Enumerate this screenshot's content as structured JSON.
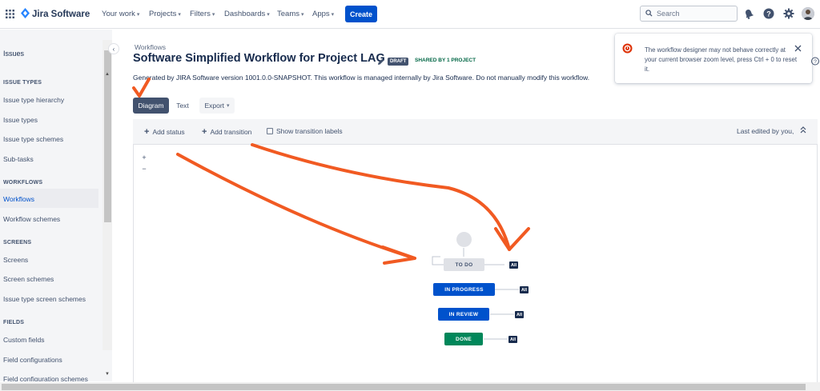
{
  "app": {
    "name": "Jira Software"
  },
  "nav": {
    "items": [
      {
        "label": "Your work"
      },
      {
        "label": "Projects"
      },
      {
        "label": "Filters"
      },
      {
        "label": "Dashboards"
      },
      {
        "label": "Teams"
      },
      {
        "label": "Apps"
      }
    ],
    "create_label": "Create",
    "search_placeholder": "Search"
  },
  "sidebar": {
    "title": "Issues",
    "sections": [
      {
        "heading": "ISSUE TYPES",
        "items": [
          "Issue type hierarchy",
          "Issue types",
          "Issue type schemes",
          "Sub-tasks"
        ]
      },
      {
        "heading": "WORKFLOWS",
        "items": [
          "Workflows",
          "Workflow schemes"
        ]
      },
      {
        "heading": "SCREENS",
        "items": [
          "Screens",
          "Screen schemes",
          "Issue type screen schemes"
        ]
      },
      {
        "heading": "FIELDS",
        "items": [
          "Custom fields",
          "Field configurations",
          "Field configuration schemes"
        ]
      }
    ],
    "active_item": "Workflows"
  },
  "page": {
    "breadcrumb": "Workflows",
    "title": "Software Simplified Workflow for Project LAG",
    "draft_label": "DRAFT",
    "shared_label": "SHARED BY 1 PROJECT",
    "description": "Generated by JIRA Software version 1001.0.0-SNAPSHOT. This workflow is managed internally by Jira Software. Do not manually modify this workflow."
  },
  "tabs": [
    {
      "label": "Diagram",
      "active": true
    },
    {
      "label": "Text"
    },
    {
      "label": "Export"
    }
  ],
  "toolbar": {
    "add_status": "Add status",
    "add_transition": "Add transition",
    "show_labels": "Show transition labels",
    "last_edited": "Last edited by you,"
  },
  "zoom": {
    "in": "+",
    "out": "−"
  },
  "workflow": {
    "statuses": [
      {
        "name": "TO DO",
        "color": "#dfe1e6",
        "text_color": "#42526e"
      },
      {
        "name": "IN PROGRESS",
        "color": "#0052cc",
        "text_color": "#ffffff"
      },
      {
        "name": "IN REVIEW",
        "color": "#0052cc",
        "text_color": "#ffffff"
      },
      {
        "name": "DONE",
        "color": "#00875a",
        "text_color": "#ffffff"
      }
    ],
    "all_label": "All"
  },
  "flag": {
    "message": "The workflow designer may not behave correctly at your current browser zoom level, press Ctrl + 0 to reset it."
  },
  "colors": {
    "brand": "#0052cc",
    "annotation": "#f15a22"
  }
}
